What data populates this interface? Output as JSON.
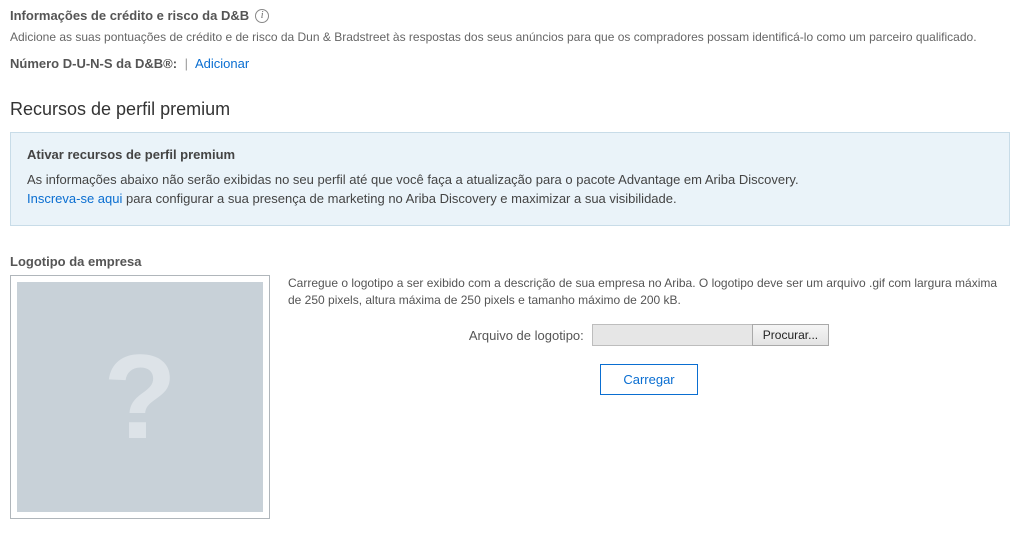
{
  "dnb": {
    "title": "Informações de crédito e risco da D&B",
    "desc": "Adicione as suas pontuações de crédito e de risco da Dun & Bradstreet às respostas dos seus anúncios para que os compradores possam identificá-lo como um parceiro qualificado.",
    "duns_label": "Número D-U-N-S da D&B®:",
    "add_link": "Adicionar"
  },
  "premium": {
    "heading": "Recursos de perfil premium",
    "notice_title": "Ativar recursos de perfil premium",
    "notice_line1": "As informações abaixo não serão exibidas no seu perfil até que você faça a atualização para o pacote Advantage em Ariba Discovery.",
    "signup_link": "Inscreva-se aqui",
    "notice_line2_rest": " para configurar a sua presença de marketing no Ariba Discovery e maximizar a sua visibilidade."
  },
  "logo": {
    "section_label": "Logotipo da empresa",
    "help": "Carregue o logotipo a ser exibido com a descrição de sua empresa no Ariba. O logotipo deve ser um arquivo .gif com largura máxima de 250 pixels, altura máxima de 250 pixels e tamanho máximo de 200 kB.",
    "file_label": "Arquivo de logotipo:",
    "browse_label": "Procurar...",
    "load_label": "Carregar",
    "placeholder_glyph": "?"
  }
}
